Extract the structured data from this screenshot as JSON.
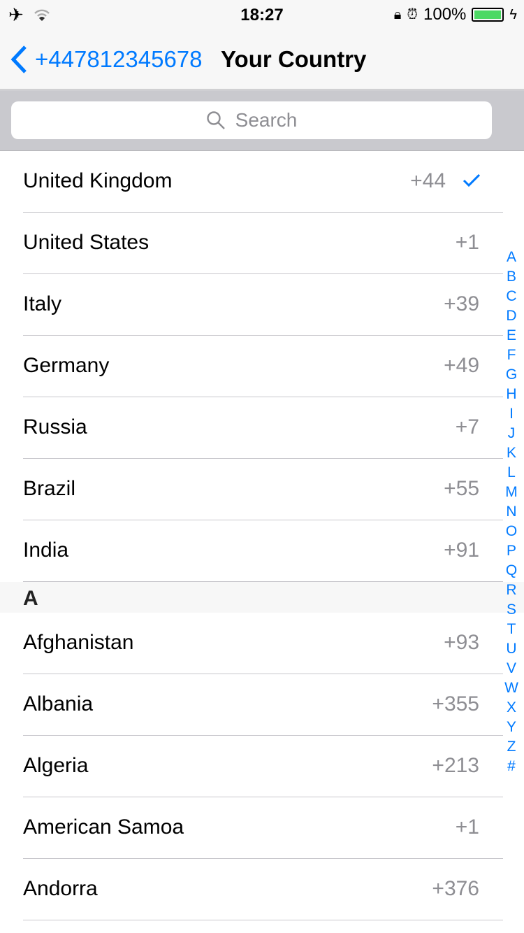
{
  "status": {
    "time": "18:27",
    "battery": "100%",
    "icons": [
      "airplane-icon",
      "wifi-icon",
      "rotation-lock-icon",
      "alarm-icon",
      "battery-icon",
      "charging-icon"
    ]
  },
  "nav": {
    "back_label": "+447812345678",
    "title": "Your Country"
  },
  "search": {
    "placeholder": "Search"
  },
  "top_countries": [
    {
      "name": "United Kingdom",
      "code": "+44",
      "selected": true
    },
    {
      "name": "United States",
      "code": "+1"
    },
    {
      "name": "Italy",
      "code": "+39"
    },
    {
      "name": "Germany",
      "code": "+49"
    },
    {
      "name": "Russia",
      "code": "+7"
    },
    {
      "name": "Brazil",
      "code": "+55"
    },
    {
      "name": "India",
      "code": "+91"
    }
  ],
  "sections": [
    {
      "letter": "A",
      "countries": [
        {
          "name": "Afghanistan",
          "code": "+93"
        },
        {
          "name": "Albania",
          "code": "+355"
        },
        {
          "name": "Algeria",
          "code": "+213"
        },
        {
          "name": "American Samoa",
          "code": "+1"
        },
        {
          "name": "Andorra",
          "code": "+376"
        }
      ]
    }
  ],
  "index": [
    "A",
    "B",
    "C",
    "D",
    "E",
    "F",
    "G",
    "H",
    "I",
    "J",
    "K",
    "L",
    "M",
    "N",
    "O",
    "P",
    "Q",
    "R",
    "S",
    "T",
    "U",
    "V",
    "W",
    "X",
    "Y",
    "Z",
    "#"
  ],
  "colors": {
    "accent": "#007aff",
    "battery": "#4cd964"
  }
}
